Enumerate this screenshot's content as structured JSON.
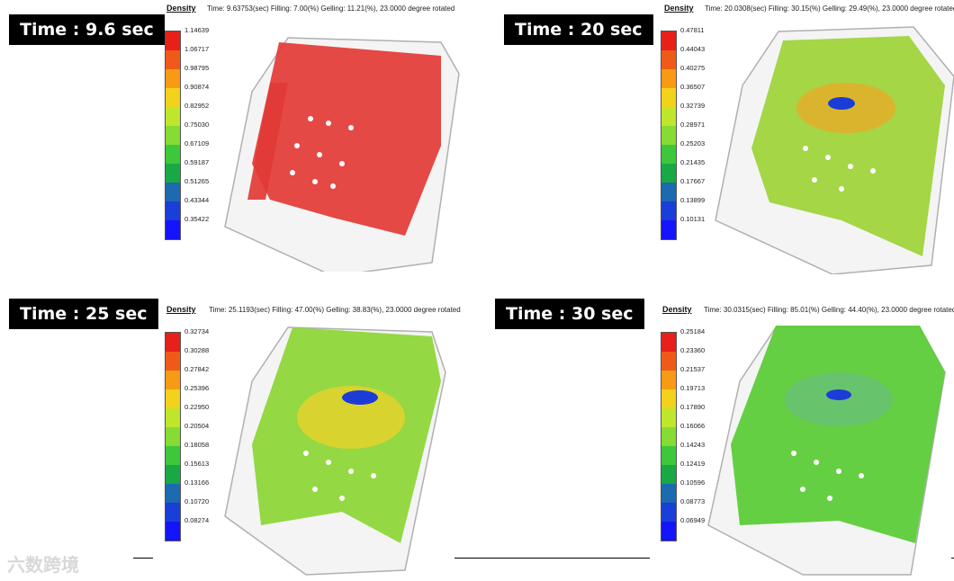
{
  "legend_title": "Density",
  "colors": [
    "#e8201a",
    "#f05a18",
    "#f79a14",
    "#f2d21a",
    "#bfe62a",
    "#86dc32",
    "#3dc83c",
    "#18a844",
    "#1c6ab0",
    "#1a3ed8",
    "#1414ff"
  ],
  "panels": [
    {
      "time_label": "Time : 9.6 sec",
      "info": "Time: 9.63753(sec)  Filling: 7.00(%)  Gelling: 11.21(%), 23.0000 degree rotated",
      "ticks": [
        "1.14639",
        "1.06717",
        "0.98795",
        "0.90874",
        "0.82952",
        "0.75030",
        "0.67109",
        "0.59187",
        "0.51265",
        "0.43344",
        "0.35422"
      ],
      "fill_color": "#e23a35"
    },
    {
      "time_label": "Time : 20 sec",
      "info": "Time: 20.0308(sec)  Filling: 30.15(%)  Gelling: 29.49(%), 23.0000 degree rotated",
      "ticks": [
        "0.47811",
        "0.44043",
        "0.40275",
        "0.36507",
        "0.32739",
        "0.28971",
        "0.25203",
        "0.21435",
        "0.17667",
        "0.13899",
        "0.10131"
      ],
      "fill_color": "#9fd43c"
    },
    {
      "time_label": "Time : 25 sec",
      "info": "Time: 25.1193(sec)  Filling: 47.00(%)  Gelling: 38.83(%), 23.0000 degree rotated",
      "ticks": [
        "0.32734",
        "0.30288",
        "0.27842",
        "0.25396",
        "0.22950",
        "0.20504",
        "0.18058",
        "0.15613",
        "0.13166",
        "0.10720",
        "0.08274"
      ],
      "fill_color": "#8ed63a"
    },
    {
      "time_label": "Time : 30 sec",
      "info": "Time: 30.0315(sec)  Filling: 85.01(%)  Gelling: 44.40(%), 23.0000 degree rotated",
      "ticks": [
        "0.25184",
        "0.23360",
        "0.21537",
        "0.19713",
        "0.17890",
        "0.16066",
        "0.14243",
        "0.12419",
        "0.10596",
        "0.08773",
        "0.06949"
      ],
      "fill_color": "#5ccc38"
    }
  ],
  "watermark": "六数跨境"
}
